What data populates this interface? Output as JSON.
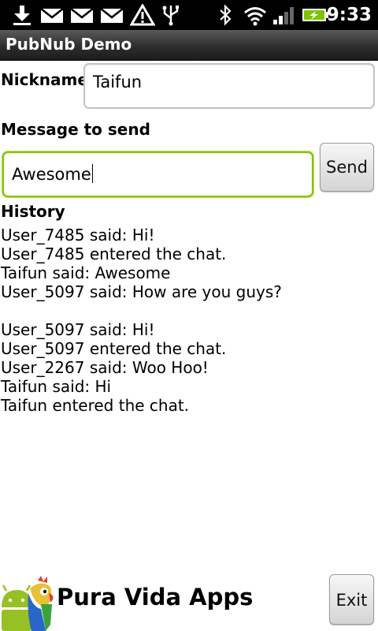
{
  "status_bar": {
    "icons": [
      "download-icon",
      "mail-icon",
      "mail-icon",
      "mail-icon",
      "warning-icon",
      "usb-icon",
      "bluetooth-icon",
      "wifi-icon",
      "signal-icon",
      "battery-charging-icon"
    ],
    "time": "9:33"
  },
  "app_title": "PubNub Demo",
  "nickname": {
    "label": "Nickname",
    "value": "Taifun"
  },
  "message": {
    "label": "Message to send",
    "value": "Awesome",
    "send_label": "Send"
  },
  "history": {
    "label": "History",
    "entries": [
      "User_7485 said: Hi!",
      "User_7485 entered the chat.",
      "Taifun said: Awesome",
      "User_5097 said: How are you guys?",
      "",
      "User_5097 said: Hi!",
      "User_5097 entered the chat.",
      "User_2267 said: Woo Hoo!",
      "Taifun said: Hi",
      "Taifun entered the chat."
    ]
  },
  "footer": {
    "brand": "Pura Vida Apps",
    "exit_label": "Exit"
  },
  "colors": {
    "focus_border": "#86c300",
    "status_bar": "#000000",
    "battery": "#7dc300"
  }
}
